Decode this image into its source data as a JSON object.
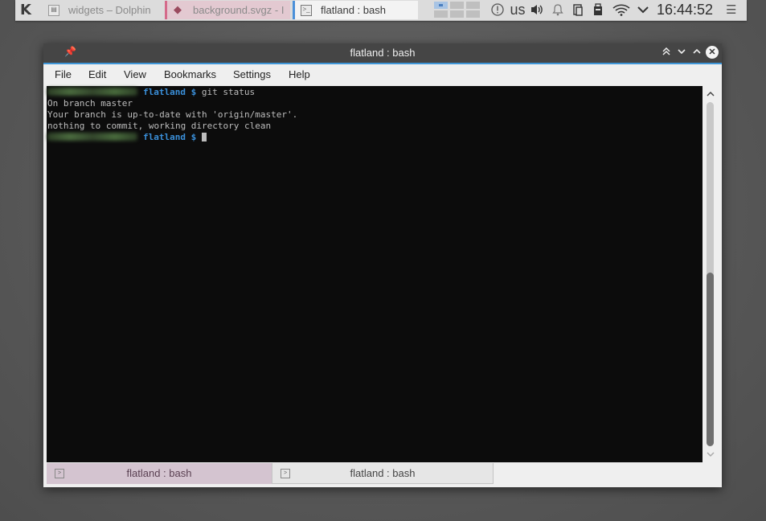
{
  "panel": {
    "launcher_icon": "kde-launcher-icon",
    "tasks": [
      {
        "label": "widgets – Dolphin",
        "icon": "dolphin-icon"
      },
      {
        "label": "background.svgz - I",
        "icon": "inkscape-icon"
      },
      {
        "label": "flatland : bash",
        "icon": "terminal-icon"
      }
    ],
    "tray": {
      "keyboard_layout": "us",
      "icons": [
        "notifications-icon",
        "volume-icon",
        "bell-icon",
        "clipboard-icon",
        "removable-device-icon",
        "wifi-icon",
        "expand-tray-icon"
      ]
    },
    "clock": "16:44:52"
  },
  "window": {
    "title": "flatland : bash",
    "menu": [
      "File",
      "Edit",
      "View",
      "Bookmarks",
      "Settings",
      "Help"
    ],
    "terminal": {
      "prompt_path": "flatland",
      "prompt_symbol": "$",
      "command": "git status",
      "output": [
        "On branch master",
        "Your branch is up-to-date with 'origin/master'.",
        "nothing to commit, working directory clean"
      ]
    },
    "tabs": [
      {
        "label": "flatland : bash",
        "active": false
      },
      {
        "label": "flatland : bash",
        "active": true
      }
    ]
  },
  "colors": {
    "accent": "#3e96d8",
    "prompt": "#3a8fd9",
    "titlebar": "#454545",
    "terminal_bg": "#0c0c0c"
  }
}
